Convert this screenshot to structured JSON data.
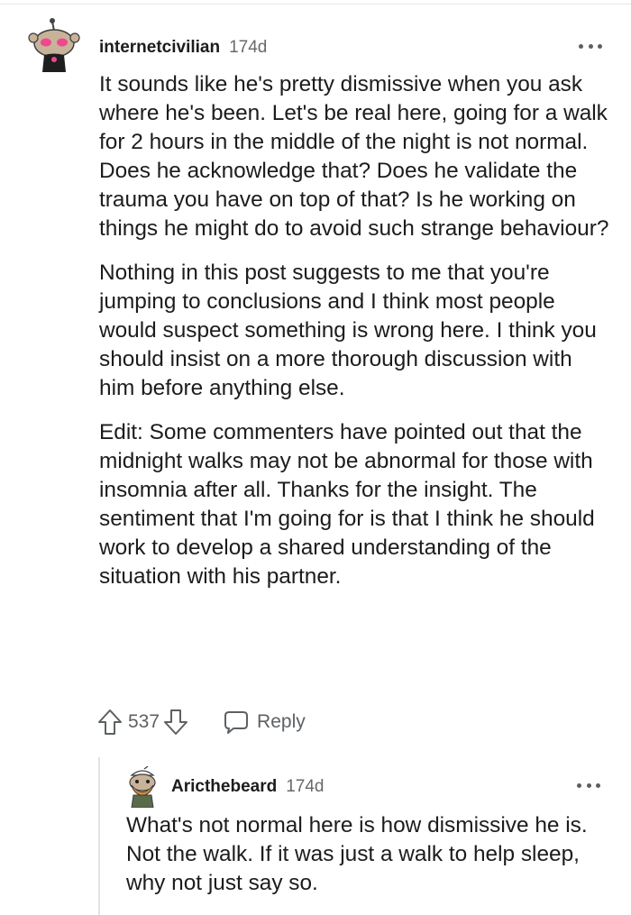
{
  "comment": {
    "username": "internetcivilian",
    "age": "174d",
    "paragraphs": [
      "It sounds like he's pretty dismissive when you ask where he's been. Let's be real here, going for a walk for 2 hours in the middle of the night is not normal. Does he acknowledge that? Does he validate the trauma you have on top of that? Is he working on things he might do to avoid such strange behaviour?",
      "Nothing in this post suggests to me that you're jumping to conclusions and I think most people would suspect something is wrong here. I think you should insist on a more thorough discussion with him before anything else.",
      "Edit: Some commenters have pointed out that the midnight walks may not be abnormal for those with insomnia after all. Thanks for the insight. The sentiment that I'm going for is that I think he should work to develop a shared understanding of the situation with his partner."
    ],
    "score": "537",
    "reply_label": "Reply",
    "icons": {
      "avatar": "snoo-avatar-icon",
      "more": "more-options-icon",
      "upvote": "upvote-arrow-icon",
      "downvote": "downvote-arrow-icon",
      "reply": "speech-bubble-icon"
    }
  },
  "reply": {
    "username": "Aricthebeard",
    "age": "174d",
    "text": "What's not normal here is how dismissive he is. Not the walk. If it was just a walk to help sleep, why not just say so.",
    "icons": {
      "avatar": "bearded-snoo-avatar-icon",
      "more": "more-options-icon"
    }
  },
  "colors": {
    "text": "#1c1c1c",
    "meta": "#666a6d",
    "icon": "#5d6164",
    "avatar_accent": "#f0478f",
    "thread_line": "#e3e3e3"
  }
}
